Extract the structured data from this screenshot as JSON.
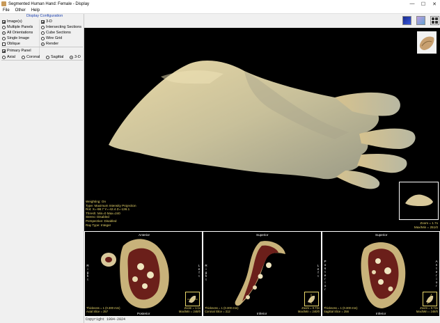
{
  "window": {
    "title": "Segmented Human Hand: Female - Display",
    "minimize": "—",
    "maximize": "☐",
    "close": "✕"
  },
  "menu": [
    "File",
    "Other",
    "Help"
  ],
  "left_panel": {
    "group_title": "Display Configuration",
    "left_col": [
      {
        "label": "Image(s)",
        "kind": "checkbox",
        "checked": true
      },
      {
        "label": "Multiple Panels",
        "kind": "radio",
        "checked": false
      },
      {
        "label": "All Orientations",
        "kind": "radio",
        "checked": true
      },
      {
        "label": "Single Image",
        "kind": "radio",
        "checked": false
      },
      {
        "label": "Oblique",
        "kind": "checkbox",
        "checked": false
      }
    ],
    "right_col": [
      {
        "label": "3-D",
        "kind": "checkbox",
        "checked": true
      },
      {
        "label": "Intersecting Sections",
        "kind": "radio",
        "checked": false
      },
      {
        "label": "Cube Sections",
        "kind": "radio",
        "checked": false
      },
      {
        "label": "Wire Grid",
        "kind": "radio",
        "checked": false
      },
      {
        "label": "Render",
        "kind": "radio",
        "checked": true
      }
    ],
    "primary_panel_label": "Primary Panel",
    "primary_panel_checked": true,
    "views": [
      {
        "label": "Axial",
        "checked": false
      },
      {
        "label": "Coronal",
        "checked": false
      },
      {
        "label": "Sagittal",
        "checked": false
      },
      {
        "label": "3-D",
        "checked": true
      }
    ]
  },
  "main_view": {
    "info_lines": [
      "Weighting: On",
      "Type: Maximum Intensity Projection",
      "Rot: X=-98.7 Y=-42.4 Z=-136.1",
      "Thresh: Min=0 Max=240",
      "Stereo: Disabled",
      "Perspective: Disabled",
      "Ray Type: Integer"
    ],
    "zoom": "Zoom = 1.7x",
    "maxmin": "Max/Min = 251/0"
  },
  "subviews": [
    {
      "top": "Anterior",
      "bottom": "Posterior",
      "left": "Right",
      "right": "Left",
      "thickness": "Thickness = 1 (0.300 mm)",
      "slice": "Axial Slice = 257",
      "zoom": "Zoom = 1.1x",
      "maxmin": "Max/Min = 248/0"
    },
    {
      "top": "Superior",
      "bottom": "Inferior",
      "left": "Right",
      "right": "Left",
      "thickness": "Thickness = 1 (0.300 mm)",
      "slice": "Coronal Slice = 312",
      "zoom": "Zoom = 0.72x",
      "maxmin": "Max/Min = 240/0"
    },
    {
      "top": "Superior",
      "bottom": "Inferior",
      "left": "Posterior",
      "right": "Anterior",
      "thickness": "Thickness = 1 (0.300 mm)",
      "slice": "Sagittal Slice = 256",
      "zoom": "Zoom = 0.72x",
      "maxmin": "Max/Min = 248/0"
    }
  ],
  "status": {
    "copyright": "Copyright 1994-2024"
  },
  "colors": {
    "overlay_text": "#e8d66a",
    "tissue": "#d8c89a",
    "muscle": "#6b1f1a",
    "background": "#000000"
  }
}
